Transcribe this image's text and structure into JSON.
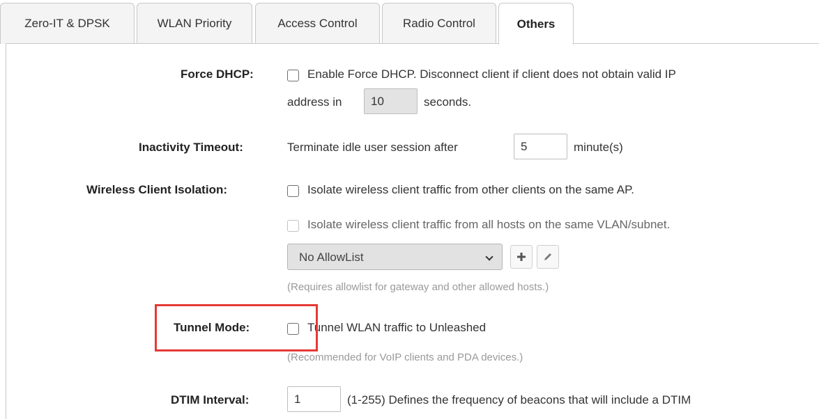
{
  "tabs": [
    {
      "label": "Zero-IT & DPSK",
      "active": false
    },
    {
      "label": "WLAN Priority",
      "active": false
    },
    {
      "label": "Access Control",
      "active": false
    },
    {
      "label": "Radio Control",
      "active": false
    },
    {
      "label": "Others",
      "active": true
    }
  ],
  "force_dhcp": {
    "label": "Force DHCP:",
    "checked": false,
    "text_line1": "Enable Force DHCP. Disconnect client if client does not obtain valid IP",
    "text_prefix": "address in",
    "seconds_value": "10",
    "text_suffix": "seconds."
  },
  "inactivity_timeout": {
    "label": "Inactivity Timeout:",
    "text_prefix": "Terminate idle user session after",
    "minutes_value": "5",
    "text_suffix": "minute(s)"
  },
  "client_isolation": {
    "label": "Wireless Client Isolation:",
    "option1_checked": false,
    "option1_text": "Isolate wireless client traffic from other clients on the same AP.",
    "option2_checked": false,
    "option2_text": "Isolate wireless client traffic from all hosts on the same VLAN/subnet.",
    "allowlist_selected": "No AllowList",
    "allowlist_hint": "(Requires allowlist for gateway and other allowed hosts.)"
  },
  "tunnel_mode": {
    "label": "Tunnel Mode:",
    "checked": false,
    "text": "Tunnel WLAN traffic to Unleashed",
    "hint": "(Recommended for VoIP clients and PDA devices.)"
  },
  "dtim_interval": {
    "label": "DTIM Interval:",
    "value": "1",
    "text": "(1-255) Defines the frequency of beacons that will include a DTIM"
  },
  "colors": {
    "highlight": "#e53935",
    "tab_border": "#c8c8c8",
    "hint_text": "#9a9a9a"
  },
  "icons": {
    "add": "plus-icon",
    "edit": "pencil-icon",
    "dropdown": "chevron-down-icon"
  }
}
